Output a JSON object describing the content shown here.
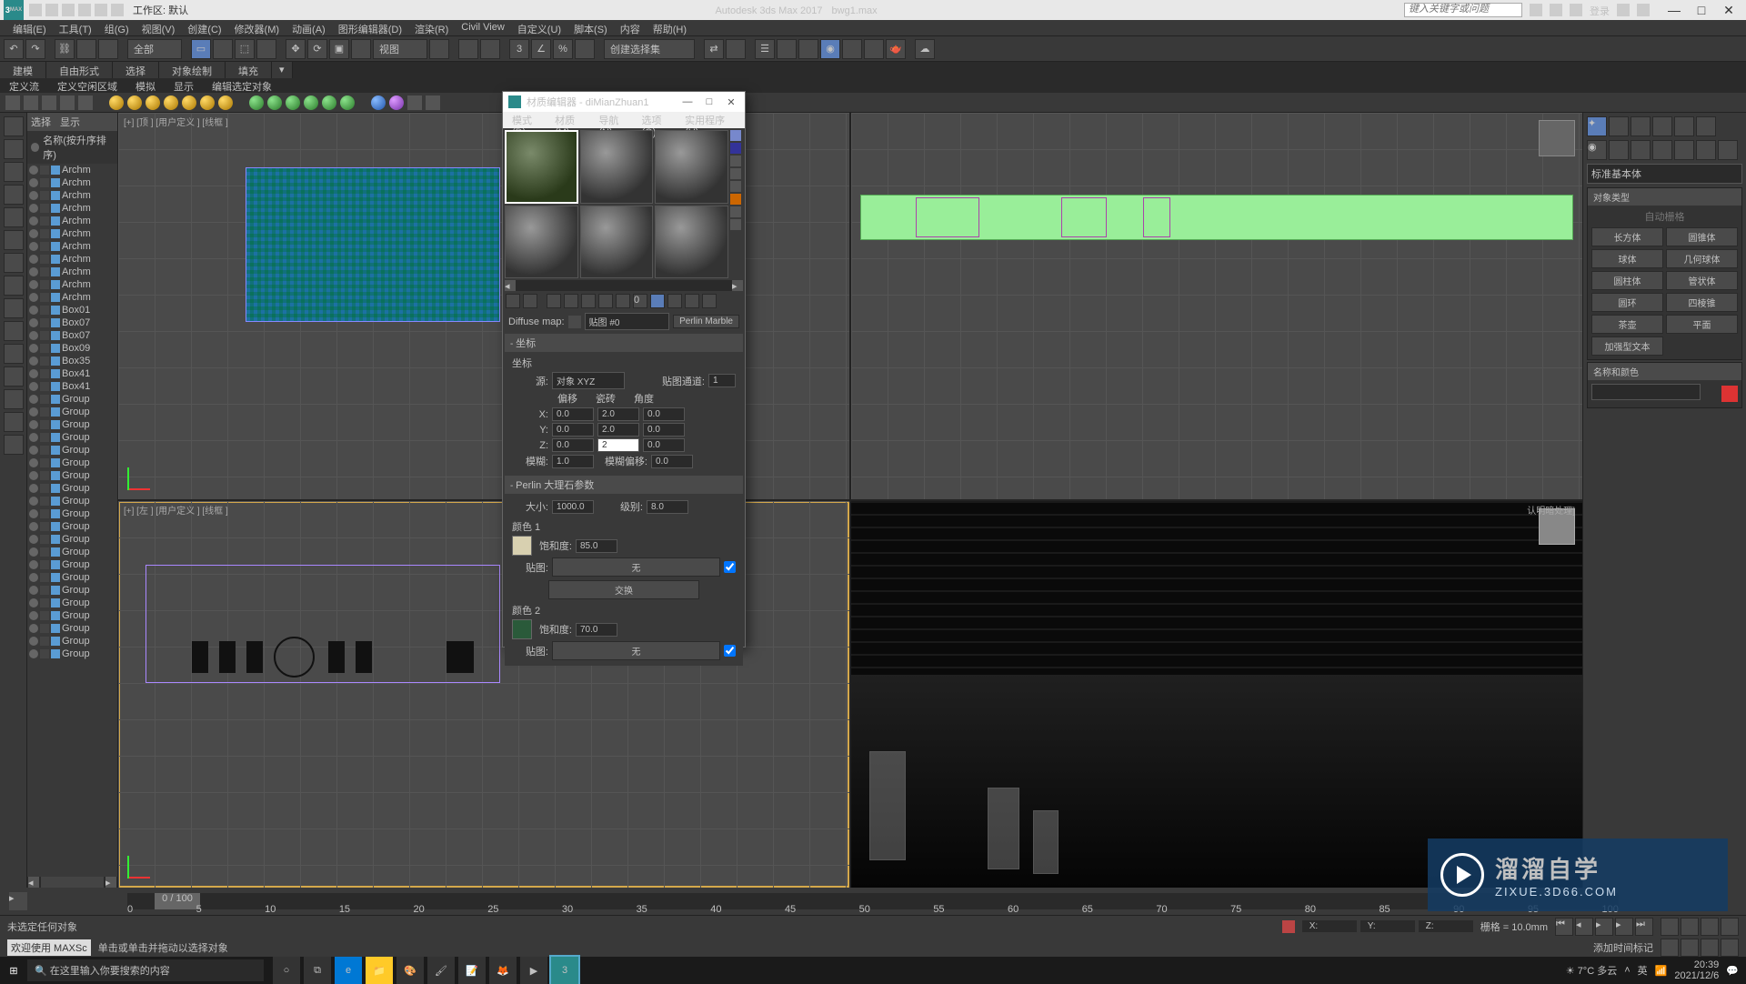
{
  "app": {
    "title": "Autodesk 3ds Max 2017",
    "file": "bwg1.max",
    "workspace_label": "工作区: 默认",
    "search_placeholder": "键入关键字或问题",
    "login": "登录"
  },
  "menu": [
    "编辑(E)",
    "工具(T)",
    "组(G)",
    "视图(V)",
    "创建(C)",
    "修改器(M)",
    "动画(A)",
    "图形编辑器(D)",
    "渲染(R)",
    "Civil View",
    "自定义(U)",
    "脚本(S)",
    "内容",
    "帮助(H)"
  ],
  "toolbar": {
    "filter": "全部",
    "create_sel": "创建选择集",
    "view": "视图"
  },
  "tabs": [
    "建模",
    "自由形式",
    "选择",
    "对象绘制",
    "填充"
  ],
  "subtabs": [
    "定义流",
    "定义空闲区域",
    "模拟",
    "显示",
    "编辑选定对象"
  ],
  "scene": {
    "hdr_sel": "选择",
    "hdr_disp": "显示",
    "sort": "名称(按升序排序)",
    "items": [
      "Archm",
      "Archm",
      "Archm",
      "Archm",
      "Archm",
      "Archm",
      "Archm",
      "Archm",
      "Archm",
      "Archm",
      "Archm",
      "Box01",
      "Box07",
      "Box07",
      "Box09",
      "Box35",
      "Box41",
      "Box41",
      "Group",
      "Group",
      "Group",
      "Group",
      "Group",
      "Group",
      "Group",
      "Group",
      "Group",
      "Group",
      "Group",
      "Group",
      "Group",
      "Group",
      "Group",
      "Group",
      "Group",
      "Group",
      "Group",
      "Group",
      "Group"
    ]
  },
  "viewports": {
    "tl": "[+] [顶 ] [用户定义 ] [线框 ]",
    "bl": "[+] [左 ] [用户定义 ] [线框 ]",
    "br_hint": "认明暗处理]"
  },
  "cmdpanel": {
    "cat": "标准基本体",
    "roll1": "对象类型",
    "autogrid": "自动栅格",
    "prims": [
      "长方体",
      "圆锥体",
      "球体",
      "几何球体",
      "圆柱体",
      "管状体",
      "圆环",
      "四棱锥",
      "茶壶",
      "平面",
      "加强型文本"
    ],
    "roll2": "名称和颜色"
  },
  "mateditor": {
    "title": "材质编辑器 - diMianZhuan1",
    "menu": [
      "模式(D)",
      "材质(M)",
      "导航(N)",
      "选项(O)",
      "实用程序(U)"
    ],
    "map_label": "Diffuse map:",
    "map_name": "贴图 #0",
    "map_type": "Perlin Marble",
    "roll_coords": "坐标",
    "coords_sub": "坐标",
    "source_lbl": "源:",
    "source_val": "对象 XYZ",
    "tile_ch": "贴图通道:",
    "tile_ch_v": "1",
    "col_off": "偏移",
    "col_til": "瓷砖",
    "col_ang": "角度",
    "x": "X:",
    "y": "Y:",
    "z": "Z:",
    "vals": {
      "ox": "0.0",
      "oy": "0.0",
      "oz": "0.0",
      "tx": "2.0",
      "ty": "2.0",
      "tz": "2",
      "ax": "0.0",
      "ay": "0.0",
      "az": "0.0"
    },
    "blur": "模糊:",
    "blur_v": "1.0",
    "bluroff": "模糊偏移:",
    "bluroff_v": "0.0",
    "roll_perlin": "Perlin 大理石参数",
    "size": "大小:",
    "size_v": "1000.0",
    "levels": "级别:",
    "levels_v": "8.0",
    "c1": "颜色 1",
    "c2": "颜色 2",
    "sat": "饱和度:",
    "sat1": "85.0",
    "sat2": "70.0",
    "map": "贴图:",
    "none": "无",
    "swap": "交换"
  },
  "timeline": {
    "pos": "0 / 100",
    "ticks": [
      "0",
      "5",
      "10",
      "15",
      "20",
      "25",
      "30",
      "35",
      "40",
      "45",
      "50",
      "55",
      "60",
      "65",
      "70",
      "75",
      "80",
      "85",
      "90",
      "95",
      "100"
    ]
  },
  "status": {
    "line1": "未选定任何对象",
    "welcome": "欢迎使用 MAXSc",
    "line2": "单击或单击并拖动以选择对象",
    "x": "X:",
    "y": "Y:",
    "z": "Z:",
    "grid": "栅格 = 10.0mm",
    "addtime": "添加时间标记"
  },
  "taskbar": {
    "search": "在这里输入你要搜索的内容",
    "weather": "7°C 多云",
    "ime": "英",
    "time": "20:39",
    "date": "2021/12/6"
  },
  "watermark": {
    "t1": "溜溜自学",
    "t2": "ZIXUE.3D66.COM"
  }
}
